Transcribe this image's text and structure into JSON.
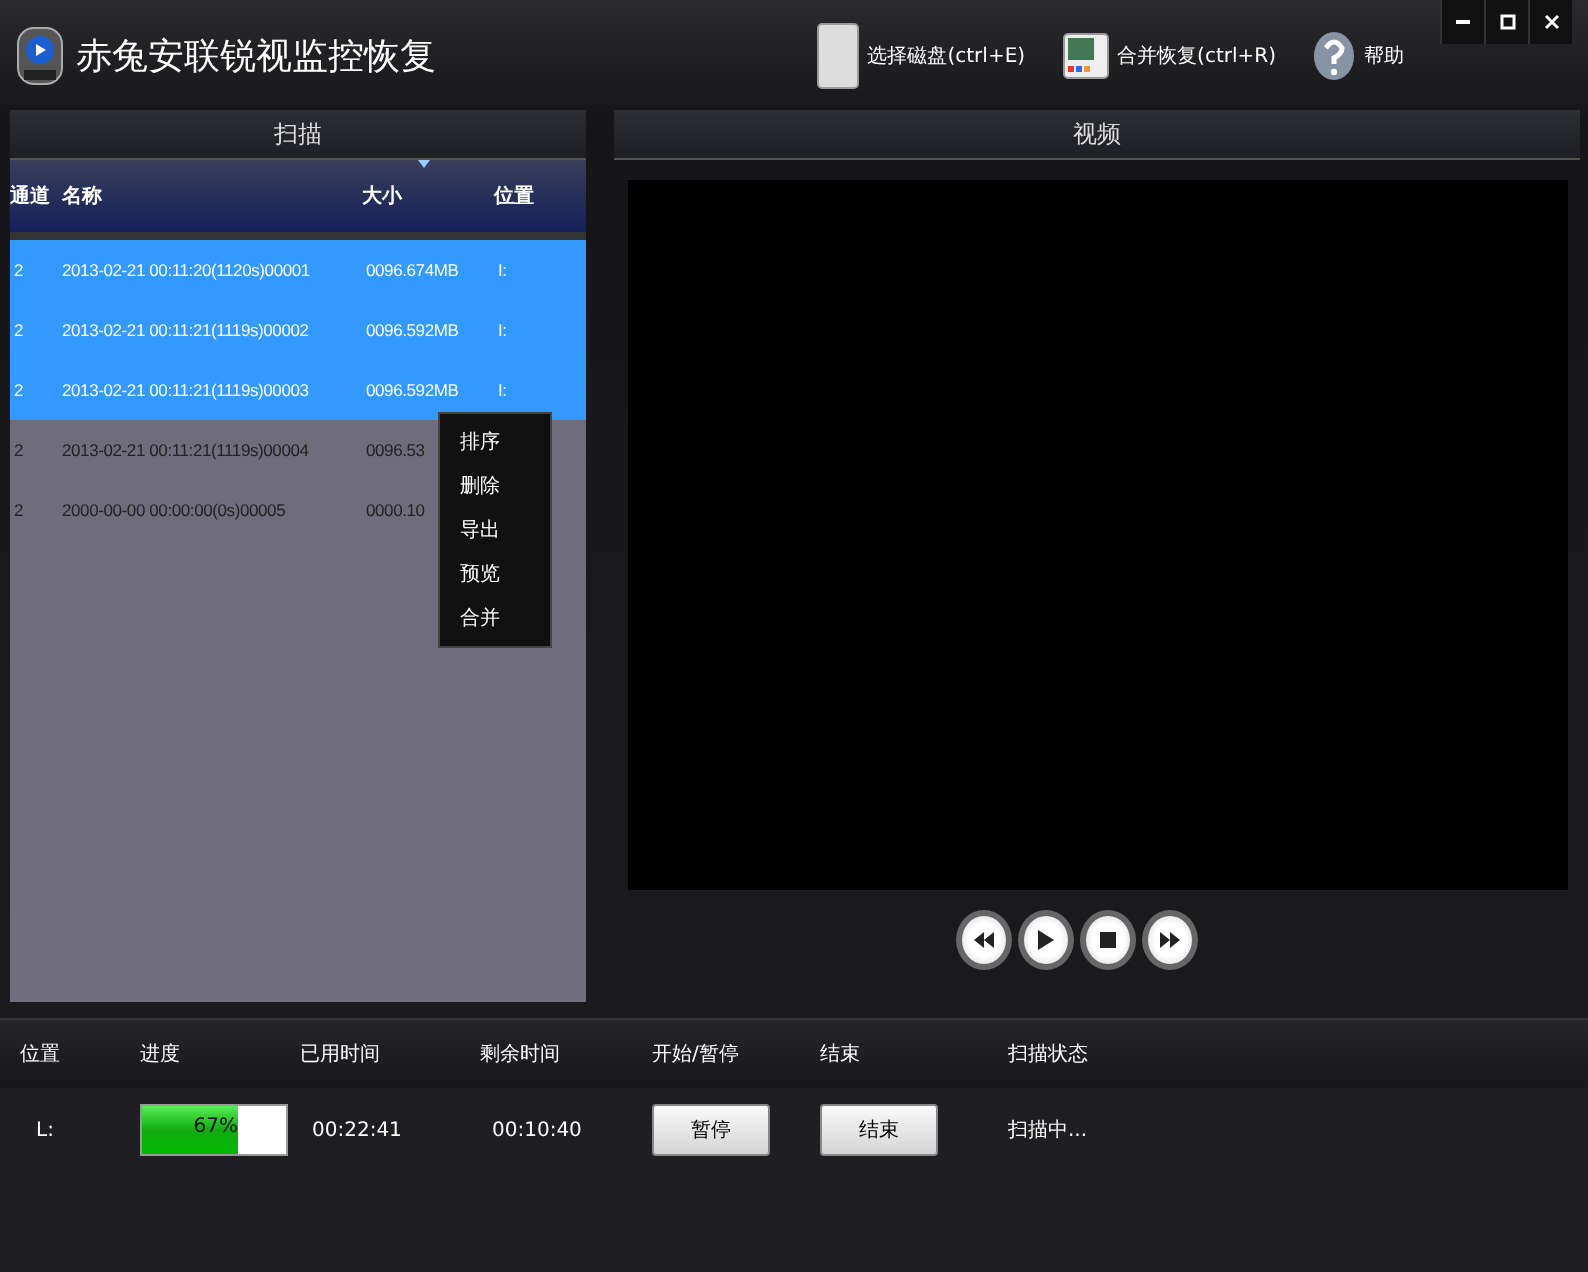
{
  "window": {
    "title": "赤兔安联锐视监控恢复"
  },
  "toolbar": [
    {
      "kind": "disk",
      "label": "选择磁盘(ctrl+E)"
    },
    {
      "kind": "merge",
      "label": "合并恢复(ctrl+R)"
    },
    {
      "kind": "help",
      "label": "帮助"
    }
  ],
  "scan_panel": {
    "title": "扫描",
    "columns": [
      "通道",
      "名称",
      "大小",
      "位置"
    ],
    "rows": [
      {
        "channel": "2",
        "name": "2013-02-21 00:11:20(1120s)00001",
        "size": "0096.674MB",
        "location": "I:",
        "selected": true
      },
      {
        "channel": "2",
        "name": "2013-02-21 00:11:21(1119s)00002",
        "size": "0096.592MB",
        "location": "I:",
        "selected": true
      },
      {
        "channel": "2",
        "name": "2013-02-21 00:11:21(1119s)00003",
        "size": "0096.592MB",
        "location": "I:",
        "selected": true
      },
      {
        "channel": "2",
        "name": "2013-02-21 00:11:21(1119s)00004",
        "size": "0096.53",
        "selected": false
      },
      {
        "channel": "2",
        "name": "2000-00-00 00:00:00(0s)00005",
        "size": "0000.10",
        "selected": false
      }
    ],
    "context_menu": [
      "排序",
      "删除",
      "导出",
      "预览",
      "合并"
    ]
  },
  "video_panel": {
    "title": "视频"
  },
  "progress_panel": {
    "columns": [
      "位置",
      "进度",
      "已用时间",
      "剩余时间",
      "开始/暂停",
      "结束",
      "扫描状态"
    ],
    "row": {
      "location": "L:",
      "level": 0.67,
      "percent": "67%",
      "elapsed": "00:22:41",
      "remaining": "00:10:40",
      "pause_button": "暂停",
      "stop_button": "结束",
      "status": "扫描中..."
    }
  }
}
